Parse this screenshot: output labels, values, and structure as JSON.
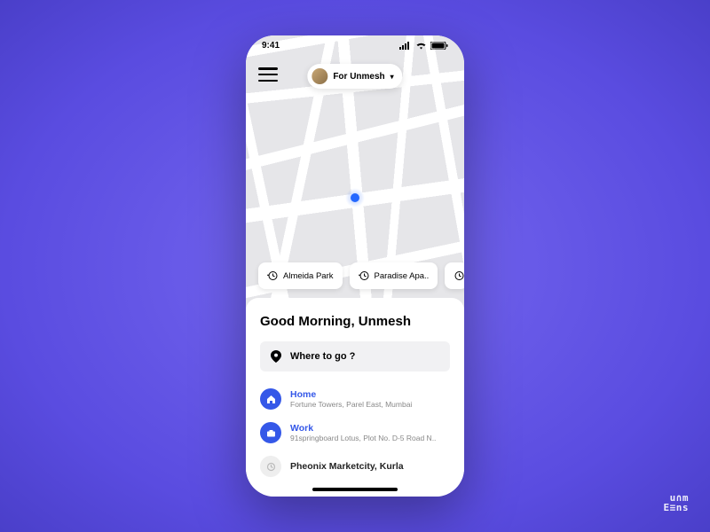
{
  "status": {
    "time": "9:41"
  },
  "header": {
    "profile_label": "For Unmesh"
  },
  "recent": [
    {
      "label": "Almeida Park"
    },
    {
      "label": "Paradise Apa.."
    }
  ],
  "sheet": {
    "greeting": "Good Morning, Unmesh",
    "search_placeholder": "Where to go ?",
    "destinations": [
      {
        "title": "Home",
        "subtitle": "Fortune Towers, Parel East, Mumbai",
        "icon": "home",
        "accent": true
      },
      {
        "title": "Work",
        "subtitle": "91springboard Lotus, Plot No. D-5 Road N..",
        "icon": "briefcase",
        "accent": true
      },
      {
        "title": "Pheonix Marketcity, Kurla",
        "subtitle": "",
        "icon": "history",
        "accent": false
      }
    ]
  },
  "brand": "unmesh",
  "colors": {
    "accent": "#3558e8",
    "bg_purple": "#6455e6"
  }
}
